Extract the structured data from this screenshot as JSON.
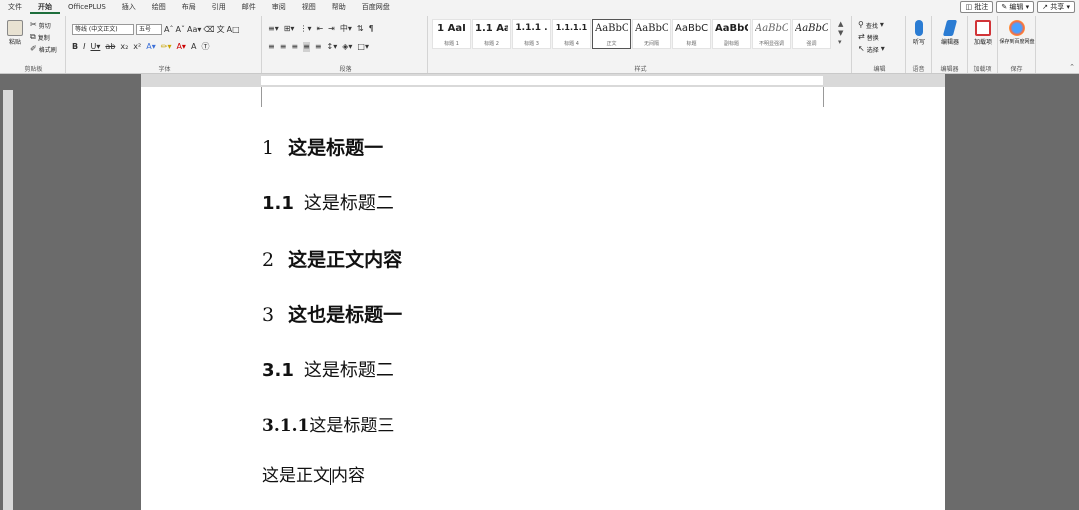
{
  "menu": {
    "tabs": [
      "文件",
      "开始",
      "OfficePLUS",
      "插入",
      "绘图",
      "布局",
      "引用",
      "邮件",
      "审阅",
      "视图",
      "帮助",
      "百度网盘"
    ],
    "active": "开始",
    "right_buttons": [
      "批注",
      "编辑",
      "共享"
    ]
  },
  "ribbon": {
    "clipboard": {
      "paste": "粘贴",
      "cut": "剪切",
      "copy": "复制",
      "format_painter": "格式刷",
      "label": "剪贴板"
    },
    "font": {
      "font_name": "等线 (中文正文)",
      "font_size": "五号",
      "label": "字体"
    },
    "paragraph": {
      "label": "段落"
    },
    "styles": {
      "label": "样式",
      "items": [
        {
          "sample": "1 AaI",
          "name": "标题 1"
        },
        {
          "sample": "1.1 Aa",
          "name": "标题 2"
        },
        {
          "sample": "1.1.1 .",
          "name": "标题 3"
        },
        {
          "sample": "1.1.1.1",
          "name": "标题 4"
        },
        {
          "sample": "AaBbC",
          "name": "正文"
        },
        {
          "sample": "AaBbC",
          "name": "无间隔"
        },
        {
          "sample": "AaBbC",
          "name": "标题"
        },
        {
          "sample": "AaBbC",
          "name": "副标题"
        },
        {
          "sample": "AaBbC",
          "name": "不明显强调"
        },
        {
          "sample": "AaBbC",
          "name": "强调"
        }
      ],
      "selected_index": 4
    },
    "editing": {
      "find": "查找",
      "replace": "替换",
      "select": "选择",
      "label": "编辑"
    },
    "voice": {
      "dictate": "听写",
      "label": "语音"
    },
    "editor": {
      "btn": "编辑器",
      "label": "编辑器"
    },
    "addins": {
      "btn": "加载项",
      "label": "加载项"
    },
    "save": {
      "btn": "保存到百度网盘",
      "label": "保存"
    }
  },
  "document": {
    "paragraphs": [
      {
        "type": "h1",
        "num": "1",
        "text": "这是标题一"
      },
      {
        "type": "h2",
        "num": "1.1",
        "text": "这是标题二"
      },
      {
        "type": "h1",
        "num": "2",
        "text": "这是正文内容"
      },
      {
        "type": "h1",
        "num": "3",
        "text": "这也是标题一"
      },
      {
        "type": "h2",
        "num": "3.1",
        "text": "这是标题二"
      },
      {
        "type": "h3",
        "num": "3.1.1",
        "text": "这是标题三"
      },
      {
        "type": "body",
        "before": "这是正文",
        "after": "内容"
      }
    ]
  },
  "colors": {
    "accent": "#1e6e3c",
    "canvas": "#6b6b6b",
    "ribbon": "#f3f3f3"
  }
}
